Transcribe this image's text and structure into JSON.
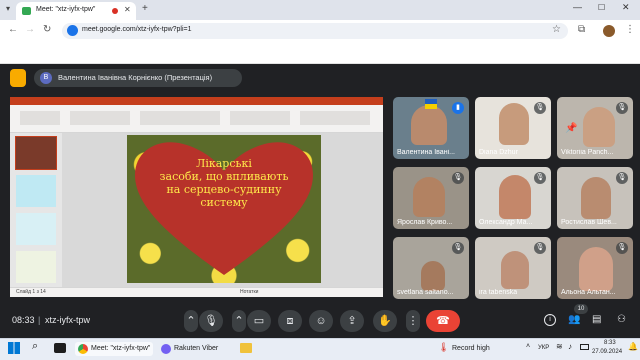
{
  "browser": {
    "tab_title": "Meet: \"xtz-iyfx-tpw\"",
    "new_tab": "+",
    "url": "meet.google.com/xtz-iyfx-tpw?pli=1"
  },
  "meet": {
    "presenter_label": "Валентина Іванівна Корнієнко (Презентація)",
    "presenter_avatar_letter": "В",
    "meeting_time": "08:33",
    "meeting_code": "xtz-iyfx-tpw",
    "participant_count": "10"
  },
  "slide": {
    "heart_text_line1": "Лікарські",
    "heart_text_line2": "засоби, що впливають",
    "heart_text_line3": "на серцево-судинну",
    "heart_text_line4": "систему",
    "ppt_status_left": "Слайд 1 з 14",
    "ppt_status_right": "Нотатки"
  },
  "participants": [
    {
      "name": "Валентина Івані..."
    },
    {
      "name": "Diana Dzhur"
    },
    {
      "name": "Viktoriia Panch..."
    },
    {
      "name": "Ярослав Криво..."
    },
    {
      "name": "Олександр Ма..."
    },
    {
      "name": "Ростислав Шев..."
    },
    {
      "name": "svetlana saltano..."
    },
    {
      "name": "ira tabenska"
    },
    {
      "name": "Альона Альтан..."
    }
  ],
  "taskbar": {
    "chrome_app": "Meet: \"xtz-iyfx-tpw\"",
    "viber_app": "Rakuten Viber",
    "record_label": "Record high",
    "lang": "УКР",
    "time": "8:33",
    "date": "27.09.2024"
  },
  "colors": {
    "meet_bg": "#202124",
    "end_call": "#ea4335",
    "ppt_accent": "#c43e1c",
    "heart": "#b7322a",
    "heart_text": "#ffe84a"
  }
}
